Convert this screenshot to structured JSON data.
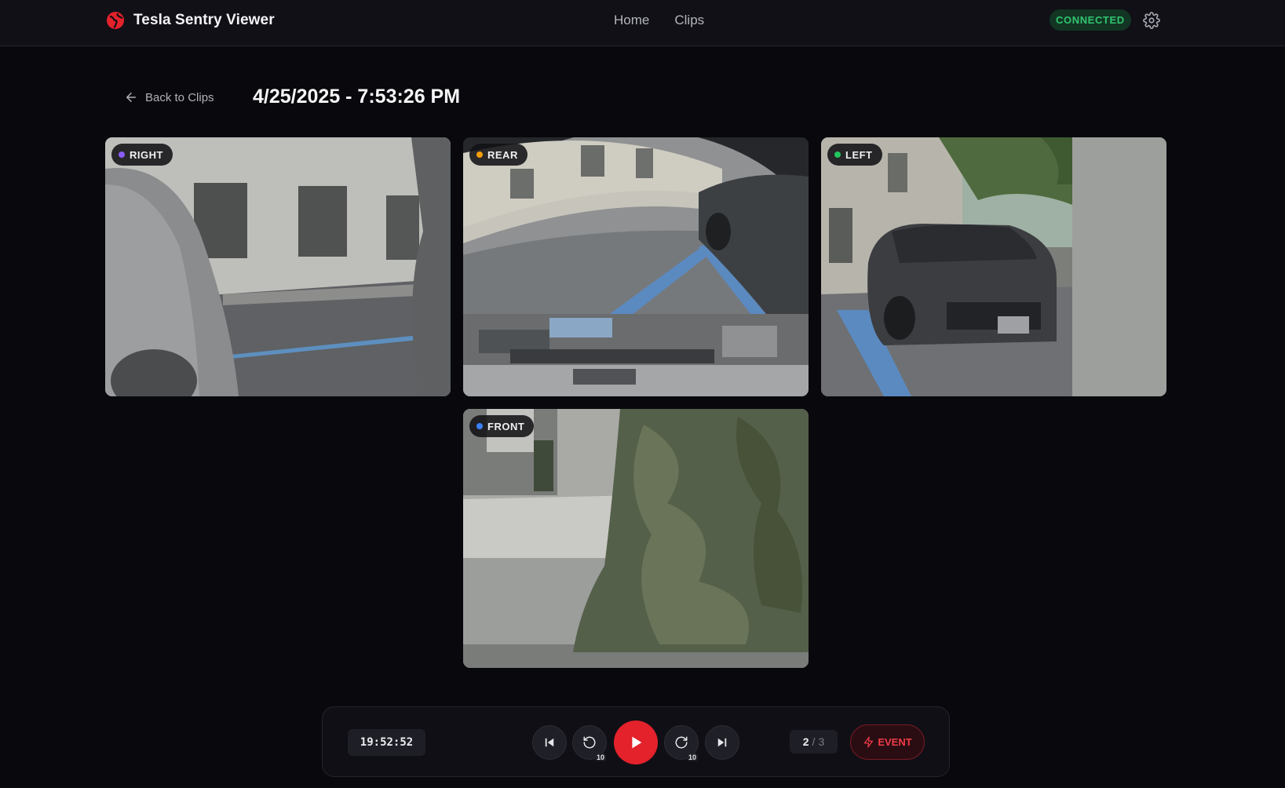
{
  "header": {
    "app_title": "Tesla Sentry Viewer",
    "nav": [
      {
        "label": "Home"
      },
      {
        "label": "Clips"
      }
    ],
    "status": "CONNECTED",
    "icons": {
      "logo": "globe-logo-icon",
      "settings": "gear-icon"
    },
    "colors": {
      "brand": "#e3222c",
      "status_text": "#32c46e",
      "status_bg": "#123524"
    }
  },
  "clip": {
    "back_label": "Back to Clips",
    "title": "4/25/2025 - 7:53:26 PM"
  },
  "cameras": [
    {
      "label": "RIGHT",
      "dot_color": "#8b5cf6"
    },
    {
      "label": "REAR",
      "dot_color": "#f59e0b"
    },
    {
      "label": "LEFT",
      "dot_color": "#22c55e"
    },
    {
      "label": "FRONT",
      "dot_color": "#3b82f6"
    }
  ],
  "player": {
    "time": "19:52:52",
    "skip_back_seconds": "10",
    "skip_forward_seconds": "10",
    "segment_current": "2",
    "segment_separator": "/",
    "segment_total": "3",
    "event_label": "EVENT",
    "icons": [
      "skip-previous-icon",
      "rewind-10-icon",
      "play-icon",
      "forward-10-icon",
      "skip-next-icon",
      "lightning-icon"
    ]
  }
}
